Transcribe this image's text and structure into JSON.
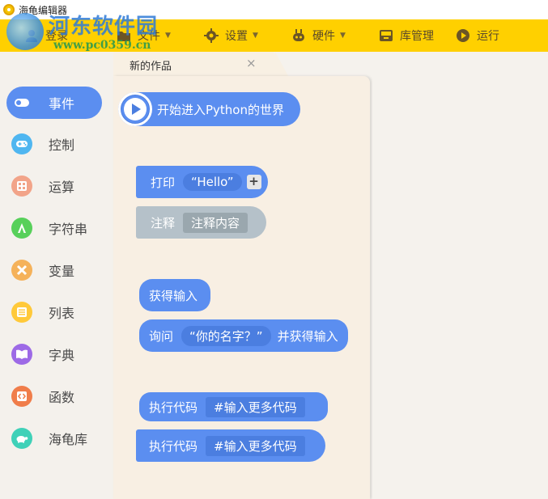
{
  "window": {
    "title": "海龟编辑器"
  },
  "watermark": {
    "text": "河东软件园",
    "url": "www.pc0359.cn"
  },
  "toolbar": {
    "login": "登录",
    "file": "文件",
    "settings": "设置",
    "hardware": "硬件",
    "library": "库管理",
    "run": "运行"
  },
  "tab": {
    "label": "新的作品",
    "close": "×"
  },
  "categories": [
    {
      "label": "事件",
      "icon": "toggle-icon",
      "color": "#5b8ef0"
    },
    {
      "label": "控制",
      "icon": "gamepad-icon",
      "color": "#4fb6f0"
    },
    {
      "label": "运算",
      "icon": "calculator-icon",
      "color": "#f2a489"
    },
    {
      "label": "字符串",
      "icon": "string-icon",
      "color": "#57d05a"
    },
    {
      "label": "变量",
      "icon": "variable-icon",
      "color": "#f5b25a"
    },
    {
      "label": "列表",
      "icon": "list-icon",
      "color": "#ffc93a"
    },
    {
      "label": "字典",
      "icon": "book-icon",
      "color": "#9d6ae6"
    },
    {
      "label": "函数",
      "icon": "function-icon",
      "color": "#f07d4a"
    },
    {
      "label": "海龟库",
      "icon": "turtle-icon",
      "color": "#3fd1b8"
    }
  ],
  "blocks": {
    "start": {
      "label": "开始进入Python的世界"
    },
    "print": {
      "label": "打印",
      "value": "“Hello”",
      "plus": "+"
    },
    "comment": {
      "label": "注释",
      "value": "注释内容"
    },
    "get_input": {
      "label": "获得输入"
    },
    "ask": {
      "label": "询问",
      "value": "“你的名字？”",
      "suffix": "并获得输入"
    },
    "exec1": {
      "label": "执行代码",
      "value": "#输入更多代码"
    },
    "exec2": {
      "label": "执行代码",
      "value": "#输入更多代码"
    }
  }
}
